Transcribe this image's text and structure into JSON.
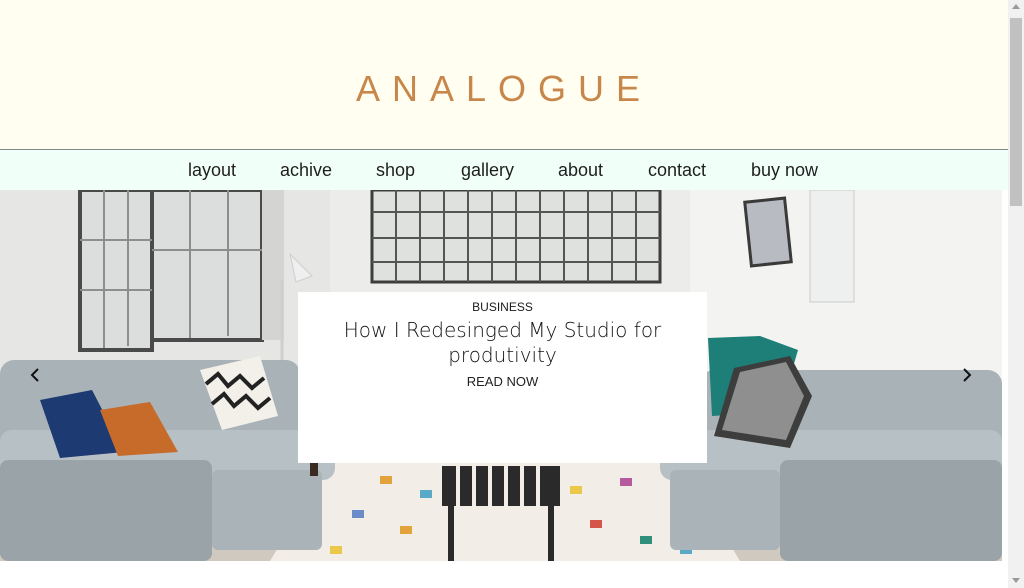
{
  "site": {
    "logo": "ANALOGUE"
  },
  "nav": {
    "items": [
      {
        "label": "layout"
      },
      {
        "label": "achive"
      },
      {
        "label": "shop"
      },
      {
        "label": "gallery"
      },
      {
        "label": "about"
      },
      {
        "label": "contact"
      },
      {
        "label": "buy now"
      }
    ]
  },
  "slider": {
    "category": "BUSINESS",
    "title": "How I Redesinged My Studio for produtivity",
    "cta": "READ NOW",
    "prev_icon": "chevron-left-icon",
    "next_icon": "chevron-right-icon"
  },
  "colors": {
    "masthead_bg": "#fffef0",
    "logo": "#c8874a",
    "nav_bg": "#f1fff9"
  }
}
